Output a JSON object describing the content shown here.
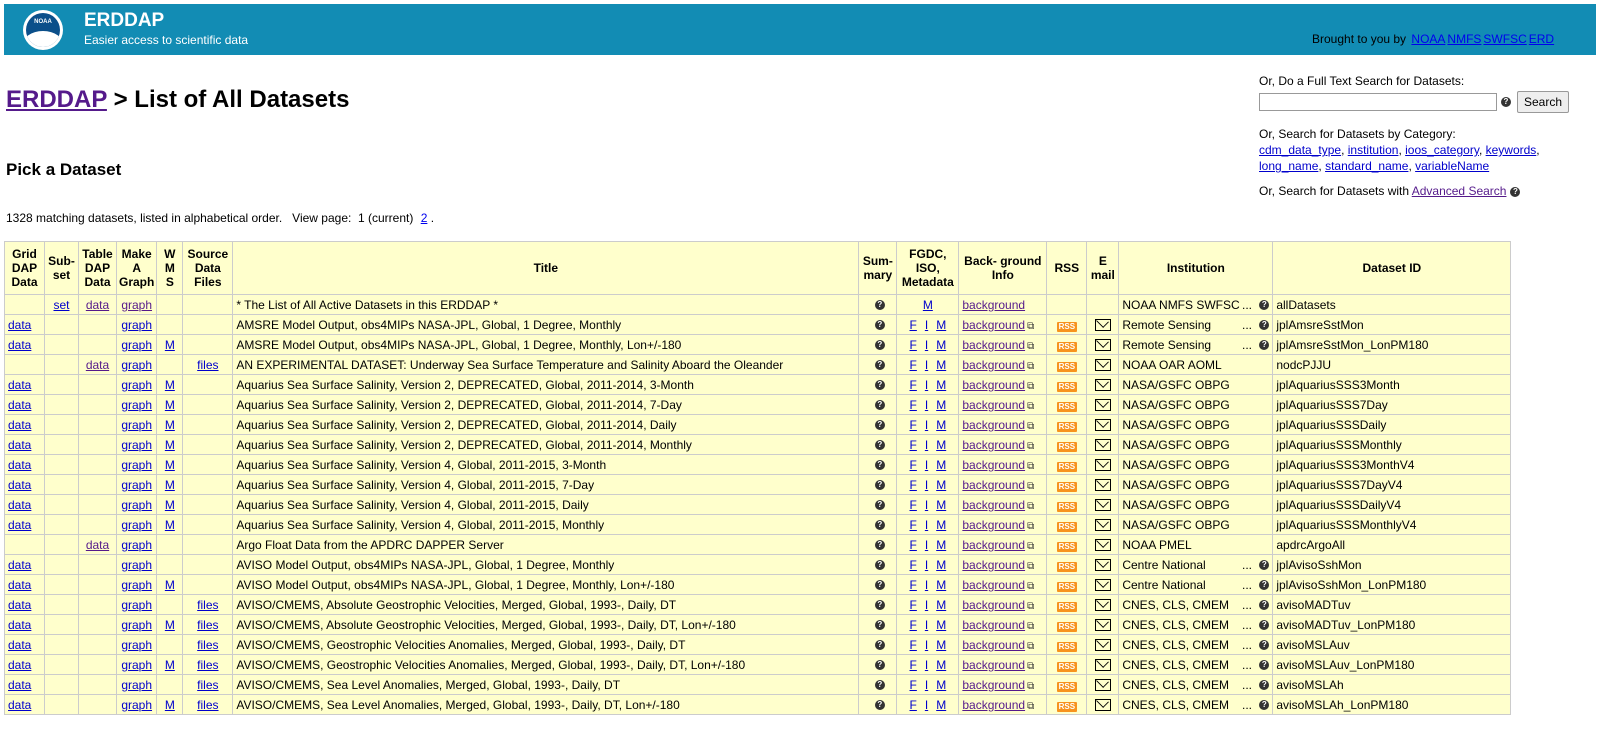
{
  "header": {
    "title": "ERDDAP",
    "subtitle": "Easier access to scientific data",
    "logo_text": "NOAA",
    "brought_by": "Brought to you by",
    "links": [
      "NOAA",
      "NMFS",
      "SWFSC",
      "ERD"
    ]
  },
  "breadcrumb": {
    "home": "ERDDAP",
    "sep": " > ",
    "current": "List of All Datasets"
  },
  "section_title": "Pick a Dataset",
  "matching": {
    "text": "1328 matching datasets, listed in alphabetical order.   View page:  1 (current)",
    "page2": "2",
    "end": "."
  },
  "search": {
    "label": "Or, Do a Full Text Search for Datasets:",
    "button": "Search",
    "category_label": "Or, Search for Datasets by Category:",
    "categories": [
      "cdm_data_type",
      "institution",
      "ioos_category",
      "keywords",
      "long_name",
      "standard_name",
      "variableName"
    ],
    "advanced_prefix": "Or, Search for Datasets with",
    "advanced_link": "Advanced Search"
  },
  "columns": {
    "griddap": "Grid DAP Data",
    "subset": "Sub- set",
    "tabledap": "Table DAP Data",
    "graph": "Make A Graph",
    "wms": "W M S",
    "files": "Source Data Files",
    "title": "Title",
    "summary": "Sum- mary",
    "fgdc": "FGDC, ISO, Metadata",
    "background": "Back- ground Info",
    "rss": "RSS",
    "email": "E mail",
    "institution": "Institution",
    "id": "Dataset ID"
  },
  "rows": [
    {
      "griddap": "",
      "subset": "set",
      "tabledap": "data",
      "graph": "graph",
      "wms": "",
      "files": "",
      "title": "* The List of All Active Datasets in this ERDDAP *",
      "f": "",
      "i": "",
      "m": "M",
      "bg": "background",
      "rss": false,
      "email": false,
      "inst": "NOAA NMFS SWFSC",
      "instmore": "...",
      "id": "allDatasets"
    },
    {
      "griddap": "data",
      "subset": "",
      "tabledap": "",
      "graph": "graph",
      "wms": "",
      "files": "",
      "title": "AMSRE Model Output, obs4MIPs NASA-JPL, Global, 1 Degree, Monthly",
      "f": "F",
      "i": "I",
      "m": "M",
      "bg": "background",
      "rss": true,
      "email": true,
      "inst": "Remote Sensing",
      "instmore": "...",
      "id": "jplAmsreSstMon"
    },
    {
      "griddap": "data",
      "subset": "",
      "tabledap": "",
      "graph": "graph",
      "wms": "M",
      "files": "",
      "title": "AMSRE Model Output, obs4MIPs NASA-JPL, Global, 1 Degree, Monthly, Lon+/-180",
      "f": "F",
      "i": "I",
      "m": "M",
      "bg": "background",
      "rss": true,
      "email": true,
      "inst": "Remote Sensing",
      "instmore": "...",
      "id": "jplAmsreSstMon_LonPM180"
    },
    {
      "griddap": "",
      "subset": "",
      "tabledap": "data",
      "graph": "graph",
      "wms": "",
      "files": "files",
      "title": "AN EXPERIMENTAL DATASET: Underway Sea Surface Temperature and Salinity Aboard the Oleander",
      "f": "F",
      "i": "I",
      "m": "M",
      "bg": "background",
      "rss": true,
      "email": true,
      "inst": "NOAA OAR AOML",
      "instmore": "",
      "id": "nodcPJJU"
    },
    {
      "griddap": "data",
      "subset": "",
      "tabledap": "",
      "graph": "graph",
      "wms": "M",
      "files": "",
      "title": "Aquarius Sea Surface Salinity, Version 2, DEPRECATED, Global, 2011-2014, 3-Month",
      "f": "F",
      "i": "I",
      "m": "M",
      "bg": "background",
      "rss": true,
      "email": true,
      "inst": "NASA/GSFC OBPG",
      "instmore": "",
      "id": "jplAquariusSSS3Month"
    },
    {
      "griddap": "data",
      "subset": "",
      "tabledap": "",
      "graph": "graph",
      "wms": "M",
      "files": "",
      "title": "Aquarius Sea Surface Salinity, Version 2, DEPRECATED, Global, 2011-2014, 7-Day",
      "f": "F",
      "i": "I",
      "m": "M",
      "bg": "background",
      "rss": true,
      "email": true,
      "inst": "NASA/GSFC OBPG",
      "instmore": "",
      "id": "jplAquariusSSS7Day"
    },
    {
      "griddap": "data",
      "subset": "",
      "tabledap": "",
      "graph": "graph",
      "wms": "M",
      "files": "",
      "title": "Aquarius Sea Surface Salinity, Version 2, DEPRECATED, Global, 2011-2014, Daily",
      "f": "F",
      "i": "I",
      "m": "M",
      "bg": "background",
      "rss": true,
      "email": true,
      "inst": "NASA/GSFC OBPG",
      "instmore": "",
      "id": "jplAquariusSSSDaily"
    },
    {
      "griddap": "data",
      "subset": "",
      "tabledap": "",
      "graph": "graph",
      "wms": "M",
      "files": "",
      "title": "Aquarius Sea Surface Salinity, Version 2, DEPRECATED, Global, 2011-2014, Monthly",
      "f": "F",
      "i": "I",
      "m": "M",
      "bg": "background",
      "rss": true,
      "email": true,
      "inst": "NASA/GSFC OBPG",
      "instmore": "",
      "id": "jplAquariusSSSMonthly"
    },
    {
      "griddap": "data",
      "subset": "",
      "tabledap": "",
      "graph": "graph",
      "wms": "M",
      "files": "",
      "title": "Aquarius Sea Surface Salinity, Version 4, Global, 2011-2015, 3-Month",
      "f": "F",
      "i": "I",
      "m": "M",
      "bg": "background",
      "rss": true,
      "email": true,
      "inst": "NASA/GSFC OBPG",
      "instmore": "",
      "id": "jplAquariusSSS3MonthV4"
    },
    {
      "griddap": "data",
      "subset": "",
      "tabledap": "",
      "graph": "graph",
      "wms": "M",
      "files": "",
      "title": "Aquarius Sea Surface Salinity, Version 4, Global, 2011-2015, 7-Day",
      "f": "F",
      "i": "I",
      "m": "M",
      "bg": "background",
      "rss": true,
      "email": true,
      "inst": "NASA/GSFC OBPG",
      "instmore": "",
      "id": "jplAquariusSSS7DayV4"
    },
    {
      "griddap": "data",
      "subset": "",
      "tabledap": "",
      "graph": "graph",
      "wms": "M",
      "files": "",
      "title": "Aquarius Sea Surface Salinity, Version 4, Global, 2011-2015, Daily",
      "f": "F",
      "i": "I",
      "m": "M",
      "bg": "background",
      "rss": true,
      "email": true,
      "inst": "NASA/GSFC OBPG",
      "instmore": "",
      "id": "jplAquariusSSSDailyV4"
    },
    {
      "griddap": "data",
      "subset": "",
      "tabledap": "",
      "graph": "graph",
      "wms": "M",
      "files": "",
      "title": "Aquarius Sea Surface Salinity, Version 4, Global, 2011-2015, Monthly",
      "f": "F",
      "i": "I",
      "m": "M",
      "bg": "background",
      "rss": true,
      "email": true,
      "inst": "NASA/GSFC OBPG",
      "instmore": "",
      "id": "jplAquariusSSSMonthlyV4"
    },
    {
      "griddap": "",
      "subset": "",
      "tabledap": "data",
      "graph": "graph",
      "wms": "",
      "files": "",
      "title": "Argo Float Data from the APDRC DAPPER Server",
      "f": "F",
      "i": "I",
      "m": "M",
      "bg": "background",
      "rss": true,
      "email": true,
      "inst": "NOAA PMEL",
      "instmore": "",
      "id": "apdrcArgoAll"
    },
    {
      "griddap": "data",
      "subset": "",
      "tabledap": "",
      "graph": "graph",
      "wms": "",
      "files": "",
      "title": "AVISO Model Output, obs4MIPs NASA-JPL, Global, 1 Degree, Monthly",
      "f": "F",
      "i": "I",
      "m": "M",
      "bg": "background",
      "rss": true,
      "email": true,
      "inst": "Centre National",
      "instmore": "...",
      "id": "jplAvisoSshMon"
    },
    {
      "griddap": "data",
      "subset": "",
      "tabledap": "",
      "graph": "graph",
      "wms": "M",
      "files": "",
      "title": "AVISO Model Output, obs4MIPs NASA-JPL, Global, 1 Degree, Monthly, Lon+/-180",
      "f": "F",
      "i": "I",
      "m": "M",
      "bg": "background",
      "rss": true,
      "email": true,
      "inst": "Centre National",
      "instmore": "...",
      "id": "jplAvisoSshMon_LonPM180"
    },
    {
      "griddap": "data",
      "subset": "",
      "tabledap": "",
      "graph": "graph",
      "wms": "",
      "files": "files",
      "title": "AVISO/CMEMS, Absolute Geostrophic Velocities, Merged, Global, 1993-, Daily, DT",
      "f": "F",
      "i": "I",
      "m": "M",
      "bg": "background",
      "rss": true,
      "email": true,
      "inst": "CNES, CLS, CMEM",
      "instmore": "...",
      "id": "avisoMADTuv"
    },
    {
      "griddap": "data",
      "subset": "",
      "tabledap": "",
      "graph": "graph",
      "wms": "M",
      "files": "files",
      "title": "AVISO/CMEMS, Absolute Geostrophic Velocities, Merged, Global, 1993-, Daily, DT, Lon+/-180",
      "f": "F",
      "i": "I",
      "m": "M",
      "bg": "background",
      "rss": true,
      "email": true,
      "inst": "CNES, CLS, CMEM",
      "instmore": "...",
      "id": "avisoMADTuv_LonPM180"
    },
    {
      "griddap": "data",
      "subset": "",
      "tabledap": "",
      "graph": "graph",
      "wms": "",
      "files": "files",
      "title": "AVISO/CMEMS, Geostrophic Velocities Anomalies, Merged, Global, 1993-, Daily, DT",
      "f": "F",
      "i": "I",
      "m": "M",
      "bg": "background",
      "rss": true,
      "email": true,
      "inst": "CNES, CLS, CMEM",
      "instmore": "...",
      "id": "avisoMSLAuv"
    },
    {
      "griddap": "data",
      "subset": "",
      "tabledap": "",
      "graph": "graph",
      "wms": "M",
      "files": "files",
      "title": "AVISO/CMEMS, Geostrophic Velocities Anomalies, Merged, Global, 1993-, Daily, DT, Lon+/-180",
      "f": "F",
      "i": "I",
      "m": "M",
      "bg": "background",
      "rss": true,
      "email": true,
      "inst": "CNES, CLS, CMEM",
      "instmore": "...",
      "id": "avisoMSLAuv_LonPM180"
    },
    {
      "griddap": "data",
      "subset": "",
      "tabledap": "",
      "graph": "graph",
      "wms": "",
      "files": "files",
      "title": "AVISO/CMEMS, Sea Level Anomalies, Merged, Global, 1993-, Daily, DT",
      "f": "F",
      "i": "I",
      "m": "M",
      "bg": "background",
      "rss": true,
      "email": true,
      "inst": "CNES, CLS, CMEM",
      "instmore": "...",
      "id": "avisoMSLAh"
    },
    {
      "griddap": "data",
      "subset": "",
      "tabledap": "",
      "graph": "graph",
      "wms": "M",
      "files": "files",
      "title": "AVISO/CMEMS, Sea Level Anomalies, Merged, Global, 1993-, Daily, DT, Lon+/-180",
      "f": "F",
      "i": "I",
      "m": "M",
      "bg": "background",
      "rss": true,
      "email": true,
      "inst": "CNES, CLS, CMEM",
      "instmore": "...",
      "id": "avisoMSLAh_LonPM180"
    }
  ]
}
